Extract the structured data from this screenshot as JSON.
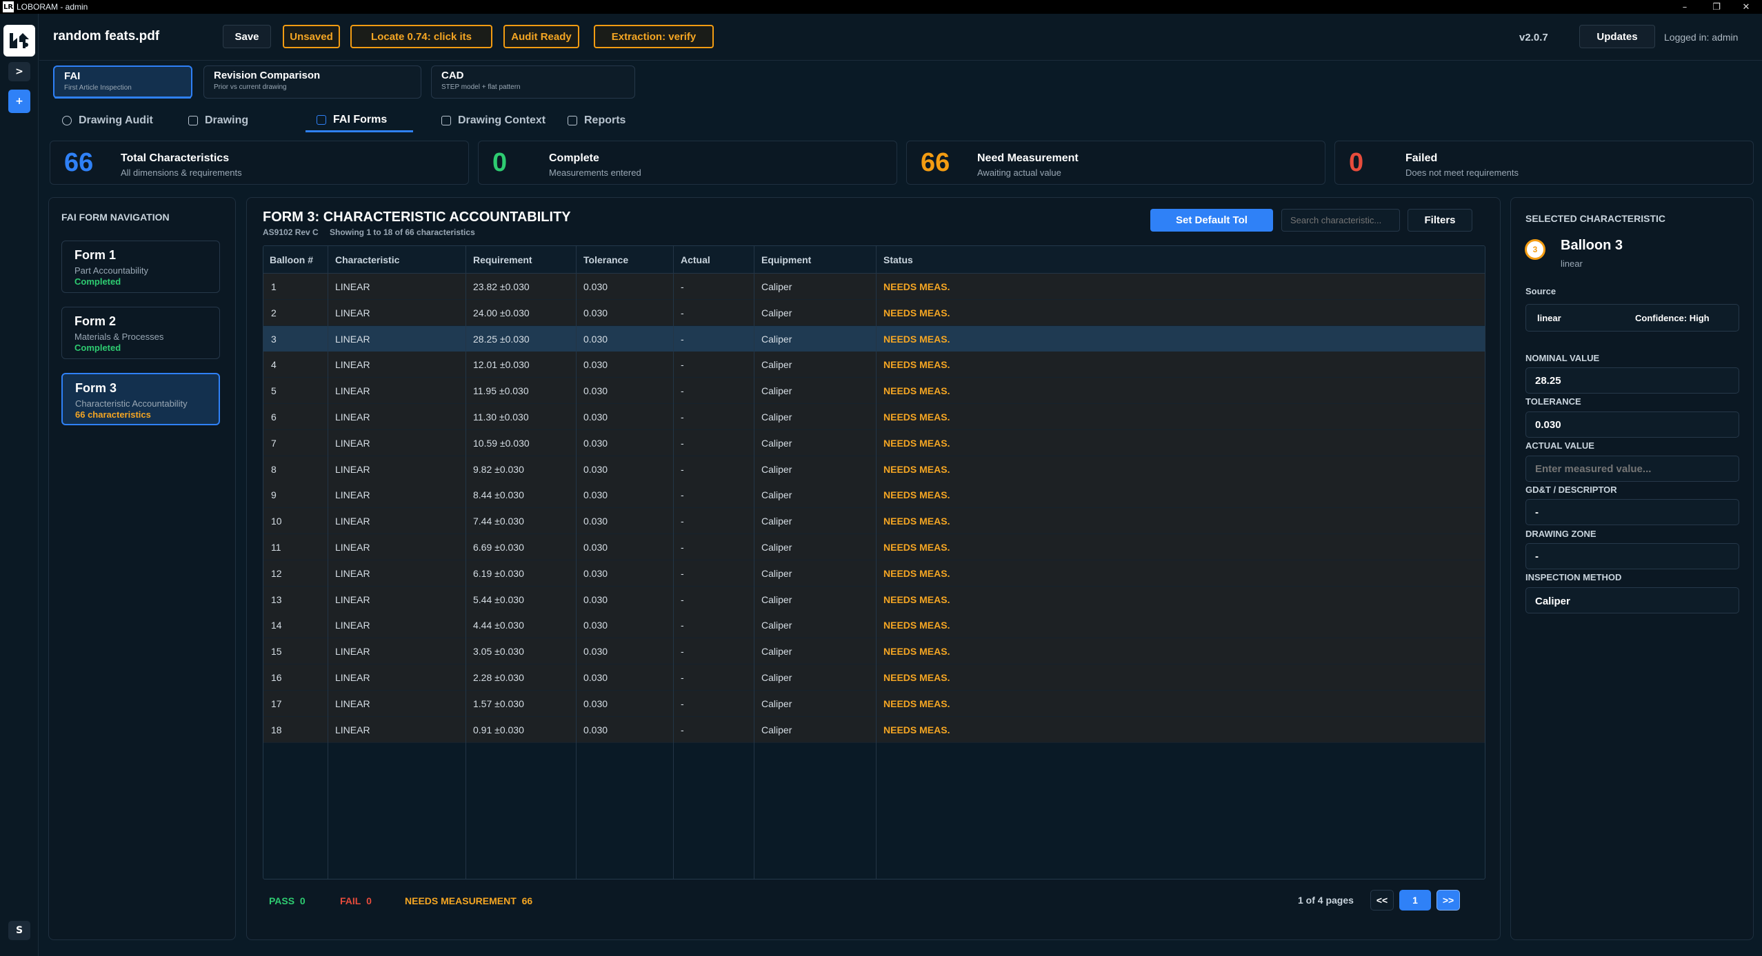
{
  "window": {
    "title": "LOBORAM - admin",
    "logo_text": "LR",
    "controls": [
      "–",
      "❐",
      "✕"
    ]
  },
  "rail": {
    "expand_label": ">",
    "add_label": "+",
    "user_initial": "S"
  },
  "header": {
    "doc_title": "random feats.pdf",
    "save_label": "Save",
    "badges": [
      "Unsaved",
      "Locate 0.74: click its",
      "Audit Ready",
      "Extraction: verify"
    ],
    "version": "v2.0.7",
    "updates_label": "Updates",
    "logged_in": "Logged in: admin"
  },
  "modes": [
    {
      "title": "FAI",
      "subtitle": "First Article Inspection"
    },
    {
      "title": "Revision Comparison",
      "subtitle": "Prior vs current drawing"
    },
    {
      "title": "CAD",
      "subtitle": "STEP model + flat pattern"
    }
  ],
  "tabs": [
    "Drawing Audit",
    "Drawing",
    "FAI Forms",
    "Drawing Context",
    "Reports"
  ],
  "stats": [
    {
      "value": "66",
      "label": "Total Characteristics",
      "sub": "All dimensions & requirements",
      "color": "#2f81f7"
    },
    {
      "value": "0",
      "label": "Complete",
      "sub": "Measurements entered",
      "color": "#2ecc71"
    },
    {
      "value": "66",
      "label": "Need Measurement",
      "sub": "Awaiting actual value",
      "color": "#f39c12"
    },
    {
      "value": "0",
      "label": "Failed",
      "sub": "Does not meet requirements",
      "color": "#e74c3c"
    }
  ],
  "nav": {
    "title": "FAI FORM NAVIGATION",
    "forms": [
      {
        "title": "Form 1",
        "desc": "Part Accountability",
        "status": "Completed"
      },
      {
        "title": "Form 2",
        "desc": "Materials & Processes",
        "status": "Completed"
      },
      {
        "title": "Form 3",
        "desc": "Characteristic Accountability",
        "status": "66 characteristics"
      }
    ]
  },
  "form3": {
    "title": "FORM 3: CHARACTERISTIC ACCOUNTABILITY",
    "spec": "AS9102 Rev C",
    "showing": "Showing 1 to 18 of 66 characteristics",
    "set_default_label": "Set Default Tol",
    "search_placeholder": "Search characteristic...",
    "filters_label": "Filters",
    "columns": [
      "Balloon #",
      "Characteristic",
      "Requirement",
      "Tolerance",
      "Actual",
      "Equipment",
      "Status"
    ],
    "rows": [
      [
        "1",
        "LINEAR",
        "23.82 ±0.030",
        "0.030",
        "-",
        "Caliper",
        "NEEDS MEAS."
      ],
      [
        "2",
        "LINEAR",
        "24.00 ±0.030",
        "0.030",
        "-",
        "Caliper",
        "NEEDS MEAS."
      ],
      [
        "3",
        "LINEAR",
        "28.25 ±0.030",
        "0.030",
        "-",
        "Caliper",
        "NEEDS MEAS."
      ],
      [
        "4",
        "LINEAR",
        "12.01 ±0.030",
        "0.030",
        "-",
        "Caliper",
        "NEEDS MEAS."
      ],
      [
        "5",
        "LINEAR",
        "11.95 ±0.030",
        "0.030",
        "-",
        "Caliper",
        "NEEDS MEAS."
      ],
      [
        "6",
        "LINEAR",
        "11.30 ±0.030",
        "0.030",
        "-",
        "Caliper",
        "NEEDS MEAS."
      ],
      [
        "7",
        "LINEAR",
        "10.59 ±0.030",
        "0.030",
        "-",
        "Caliper",
        "NEEDS MEAS."
      ],
      [
        "8",
        "LINEAR",
        "9.82 ±0.030",
        "0.030",
        "-",
        "Caliper",
        "NEEDS MEAS."
      ],
      [
        "9",
        "LINEAR",
        "8.44 ±0.030",
        "0.030",
        "-",
        "Caliper",
        "NEEDS MEAS."
      ],
      [
        "10",
        "LINEAR",
        "7.44 ±0.030",
        "0.030",
        "-",
        "Caliper",
        "NEEDS MEAS."
      ],
      [
        "11",
        "LINEAR",
        "6.69 ±0.030",
        "0.030",
        "-",
        "Caliper",
        "NEEDS MEAS."
      ],
      [
        "12",
        "LINEAR",
        "6.19 ±0.030",
        "0.030",
        "-",
        "Caliper",
        "NEEDS MEAS."
      ],
      [
        "13",
        "LINEAR",
        "5.44 ±0.030",
        "0.030",
        "-",
        "Caliper",
        "NEEDS MEAS."
      ],
      [
        "14",
        "LINEAR",
        "4.44 ±0.030",
        "0.030",
        "-",
        "Caliper",
        "NEEDS MEAS."
      ],
      [
        "15",
        "LINEAR",
        "3.05 ±0.030",
        "0.030",
        "-",
        "Caliper",
        "NEEDS MEAS."
      ],
      [
        "16",
        "LINEAR",
        "2.28 ±0.030",
        "0.030",
        "-",
        "Caliper",
        "NEEDS MEAS."
      ],
      [
        "17",
        "LINEAR",
        "1.57 ±0.030",
        "0.030",
        "-",
        "Caliper",
        "NEEDS MEAS."
      ],
      [
        "18",
        "LINEAR",
        "0.91 ±0.030",
        "0.030",
        "-",
        "Caliper",
        "NEEDS MEAS."
      ]
    ],
    "selected_row": 3,
    "summary": {
      "pass_label": "PASS",
      "pass": "0",
      "fail_label": "FAIL",
      "fail": "0",
      "needs_label": "NEEDS MEASUREMENT",
      "needs": "66"
    },
    "pager": {
      "text": "1 of 4 pages",
      "prev": "<<",
      "current": "1",
      "next": ">>"
    }
  },
  "selected": {
    "section_title": "SELECTED CHARACTERISTIC",
    "balloon_num": "3",
    "balloon_title": "Balloon 3",
    "balloon_type": "linear",
    "source_label": "Source",
    "source_value": "linear",
    "confidence": "Confidence: High",
    "nominal_label": "NOMINAL VALUE",
    "nominal": "28.25",
    "tolerance_label": "TOLERANCE",
    "tolerance": "0.030",
    "actual_label": "ACTUAL VALUE",
    "actual_placeholder": "Enter measured value...",
    "gdt_label": "GD&T / DESCRIPTOR",
    "gdt": "-",
    "zone_label": "DRAWING ZONE",
    "zone": "-",
    "method_label": "INSPECTION METHOD",
    "method": "Caliper"
  },
  "colors": {
    "accent": "#2f81f7",
    "warning": "#f39c12",
    "success": "#2ecc71",
    "danger": "#e74c3c"
  }
}
